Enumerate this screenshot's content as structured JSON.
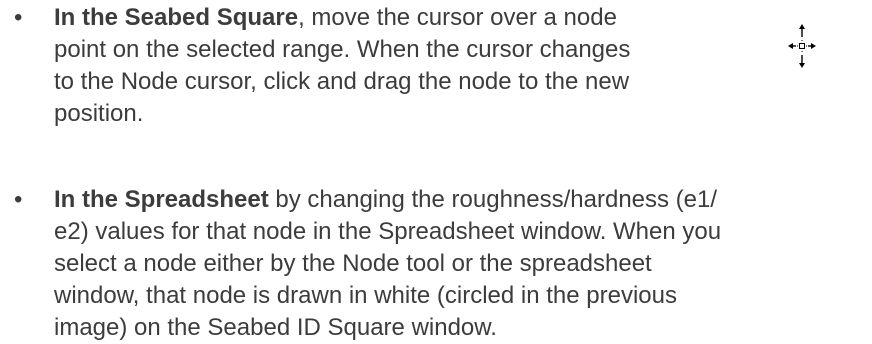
{
  "bullets": [
    {
      "lead": "In the Seabed Square",
      "lines": [
        ", move the cursor over a node",
        "point on the selected range. When the cursor changes",
        "to the Node cursor, click and drag the node to the new",
        "position."
      ],
      "icon": "node-cursor-icon"
    },
    {
      "lead": "In the Spreadsheet",
      "lines": [
        " by changing the roughness/hardness (e1/",
        "e2) values for that node in the Spreadsheet window. When you",
        "select a node either by the Node tool or the spreadsheet",
        "window, that node is drawn in white (circled in the previous",
        "image) on the Seabed ID Square window."
      ]
    }
  ],
  "bullet_symbol": "•"
}
